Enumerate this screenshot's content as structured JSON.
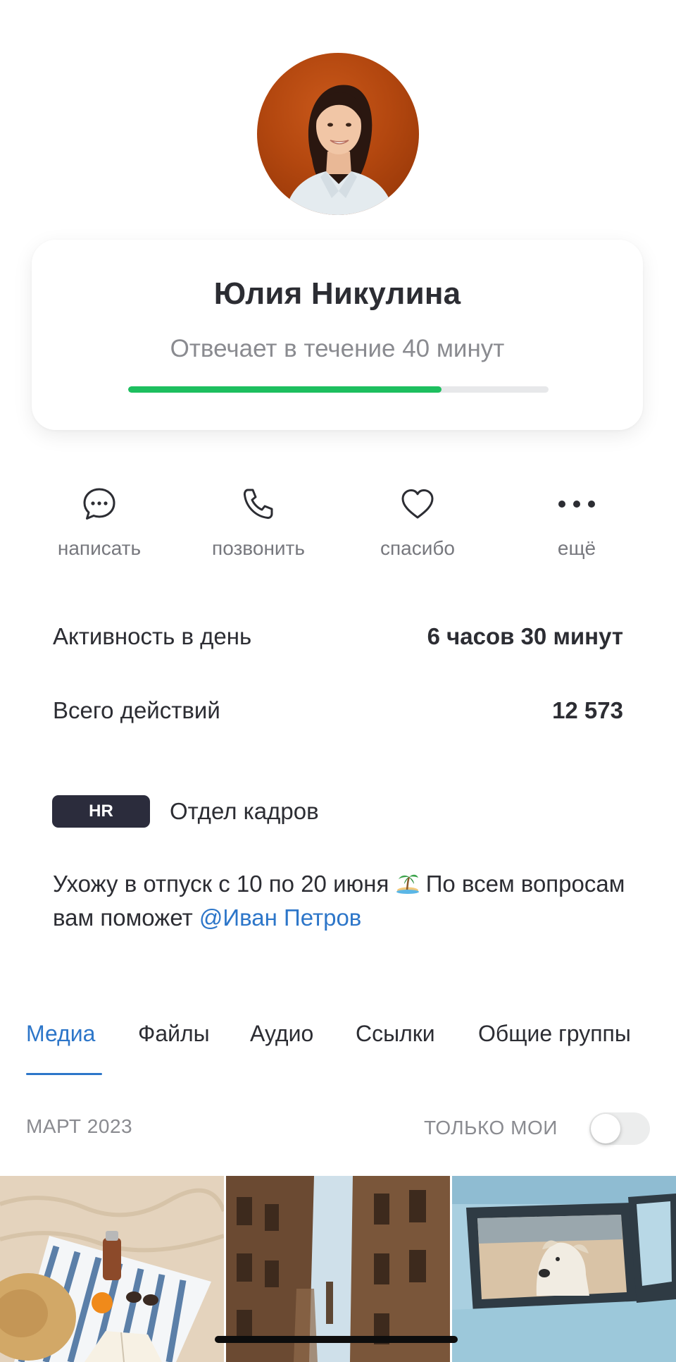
{
  "profile": {
    "name": "Юлия Никулина",
    "response_status": "Отвечает в течение 40 минут",
    "response_progress_percent": 74.5,
    "avatar": "profile-photo"
  },
  "actions": [
    {
      "icon": "chat-bubble-icon",
      "label": "написать"
    },
    {
      "icon": "phone-icon",
      "label": "позвонить"
    },
    {
      "icon": "heart-icon",
      "label": "спасибо"
    },
    {
      "icon": "more-dots-icon",
      "label": "ещё"
    }
  ],
  "stats": [
    {
      "label": "Активность в день",
      "value": "6 часов 30 минут"
    },
    {
      "label": "Всего действий",
      "value": "12 573"
    }
  ],
  "department": {
    "badge": "HR",
    "name": "Отдел кадров"
  },
  "status_note": {
    "text_before_emoji": "Ухожу в отпуск с 10 по 20 июня",
    "emoji": "desert-island-emoji",
    "text_after_emoji": "По всем вопросам вам поможет",
    "mention": "@Иван Петров"
  },
  "tabs": [
    {
      "label": "Медиа",
      "active": true
    },
    {
      "label": "Файлы",
      "active": false
    },
    {
      "label": "Аудио",
      "active": false
    },
    {
      "label": "Ссылки",
      "active": false
    },
    {
      "label": "Общие группы",
      "active": false
    }
  ],
  "media_section": {
    "date_header": "МАРТ 2023",
    "only_mine_label": "ТОЛЬКО МОИ",
    "only_mine_enabled": false,
    "items": [
      {
        "alt": "beach-picnic-photo"
      },
      {
        "alt": "old-city-street-photo"
      },
      {
        "alt": "dog-in-car-window-photo"
      }
    ]
  },
  "colors": {
    "accent": "#2d76c9",
    "progress": "#1dbf5f",
    "text_primary": "#2c2d33",
    "text_secondary": "#8a8b90",
    "badge_bg": "#2b2c3c"
  }
}
